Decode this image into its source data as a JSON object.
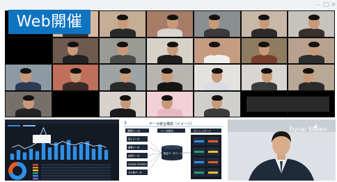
{
  "badge": {
    "label": "Web開催"
  },
  "window": {
    "controls": [
      "–",
      "□",
      "×"
    ]
  },
  "participants": [
    {
      "row": 0,
      "col": 1,
      "bg": "#d7b79e",
      "shirt": "#333333"
    },
    {
      "row": 0,
      "col": 2,
      "bg": "#c6ad95",
      "shirt": "#2a2a2a"
    },
    {
      "row": 0,
      "col": 3,
      "bg": "#a77d68",
      "shirt": "#d9d5d0"
    },
    {
      "row": 0,
      "col": 4,
      "bg": "#8a8f92",
      "shirt": "#3a3a3a"
    },
    {
      "row": 0,
      "col": 5,
      "bg": "#c9b8a8",
      "shirt": "#2b2b2b"
    },
    {
      "row": 0,
      "col": 6,
      "bg": "#c6c3bf",
      "shirt": "#3a2f2a"
    },
    {
      "row": 1,
      "col": 1,
      "bg": "#6f5a4f",
      "shirt": "#222222"
    },
    {
      "row": 1,
      "col": 2,
      "bg": "#9b9b95",
      "shirt": "#4a4a4a"
    },
    {
      "row": 1,
      "col": 3,
      "bg": "#d7d2c8",
      "shirt": "#1e1e1e"
    },
    {
      "row": 1,
      "col": 4,
      "bg": "#c59c81",
      "shirt": "#f0eeea"
    },
    {
      "row": 1,
      "col": 5,
      "bg": "#8f7b60",
      "shirt": "#7a3d2c"
    },
    {
      "row": 1,
      "col": 6,
      "bg": "#b8a28e",
      "shirt": "#2e2e2e"
    },
    {
      "row": 2,
      "col": 0,
      "bg": "#8e9aa3",
      "shirt": "#2c3a55"
    },
    {
      "row": 2,
      "col": 1,
      "bg": "#c06f5b",
      "shirt": "#3b2a25"
    },
    {
      "row": 2,
      "col": 2,
      "bg": "#9ea3a3",
      "shirt": "#2a2a2a"
    },
    {
      "row": 2,
      "col": 3,
      "bg": "#b8b5b1",
      "shirt": "#151515"
    },
    {
      "row": 2,
      "col": 4,
      "bg": "#e4e2de",
      "shirt": "#d9dde1"
    },
    {
      "row": 2,
      "col": 5,
      "bg": "#d9d6d1",
      "shirt": "#3b3b3b"
    },
    {
      "row": 2,
      "col": 6,
      "bg": "#b9a896",
      "shirt": "#2a2a2a"
    },
    {
      "row": 3,
      "col": 0,
      "bg": "#77706a",
      "shirt": "#232323"
    },
    {
      "row": 3,
      "col": 2,
      "bg": "#d7d2cc",
      "shirt": "#1a1a1a"
    },
    {
      "row": 3,
      "col": 3,
      "bg": "#f2d0d8",
      "shirt": "#e8b8c5"
    },
    {
      "row": 3,
      "col": 4,
      "bg": "#d1cfcc",
      "shirt": "#3b3b3b"
    }
  ],
  "dashboard": {
    "bars": [
      5,
      8,
      6,
      9,
      7,
      18,
      10,
      14,
      12,
      16,
      11,
      13,
      15,
      9,
      12,
      8
    ],
    "line": [
      10,
      12,
      9,
      11,
      14,
      26,
      13,
      12,
      15,
      13,
      12,
      14,
      13,
      11,
      12,
      10
    ],
    "donut": [
      {
        "value": 70,
        "color": "#2f8fe6"
      },
      {
        "value": 30,
        "color": "#e85d1f"
      }
    ],
    "legend_colors": [
      "#2f8fe6",
      "#7fbfff"
    ],
    "table_cell_colors": [
      "#d6454b",
      "#e88b2a",
      "#e8c22a",
      "#2a9c6b",
      "#2f8fe6",
      "#8b5fd6"
    ]
  },
  "slide": {
    "title": "データ統合構想（イメージ）",
    "number": "3",
    "header_left": "業務データ",
    "header_mid": "データ統合",
    "header_right": "ダッシュボード",
    "left_boxes": [
      "売上データ",
      "顧客データ",
      "在庫データ",
      "Google Analytics",
      "その他データ"
    ],
    "center_label": "統合データベース"
  },
  "presenter": {
    "logo": "Funai Soken",
    "bg": "#dde1e5",
    "suit": "#1f2a3a"
  }
}
